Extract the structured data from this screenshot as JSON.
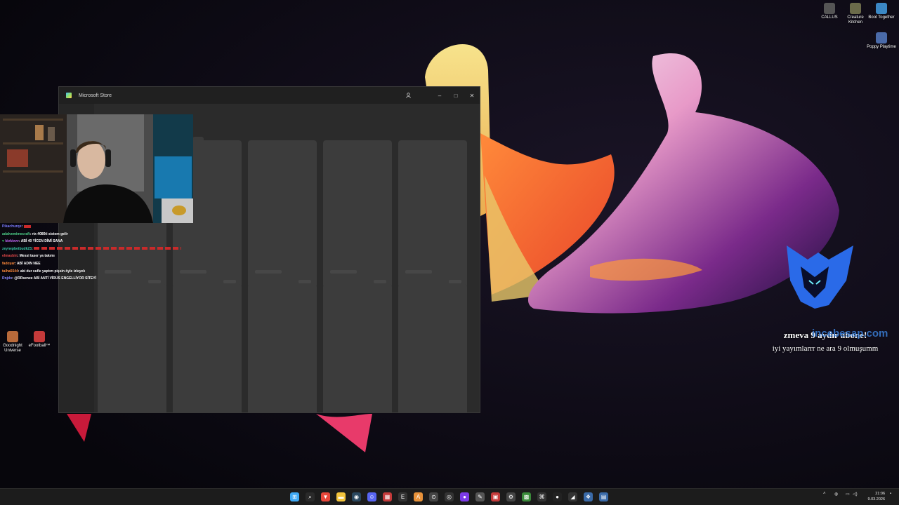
{
  "desktop": {
    "icons_right": [
      {
        "label": "CALLUS",
        "icon": "game-icon",
        "color": "#555555"
      },
      {
        "label": "Creature Kitchen",
        "icon": "game-icon",
        "color": "#6b6b4a"
      },
      {
        "label": "Boot Together",
        "icon": "game-icon",
        "color": "#3b88c4"
      },
      {
        "label": "Poppy Playtime",
        "icon": "game-icon",
        "color": "#4a6aa8"
      }
    ],
    "icons_left": [
      {
        "label": "Goodnight Universe",
        "icon": "game-icon",
        "color": "#b86a3a"
      },
      {
        "label": "eFootball™",
        "icon": "game-icon",
        "color": "#c43a3a"
      }
    ]
  },
  "store_window": {
    "title": "Microsoft Store",
    "buttons": {
      "account": "account-icon",
      "minimize": "–",
      "maximize": "□",
      "close": "✕"
    },
    "loading": true
  },
  "chat": [
    {
      "user": "Pikachuzqe",
      "user_color": "#7b7bff",
      "message": "",
      "message_color": "#ff3b3b"
    },
    {
      "user": "adalvemimecraft",
      "user_color": "#4fd18a",
      "message": "rtx 4080ti sistem gelir",
      "message_color": "#ffffff"
    },
    {
      "user": "kivkivvv",
      "user_color": "#c86cff",
      "message": "ABİ 40 YİCEN DİMİ SANA",
      "message_color": "#ffffff"
    },
    {
      "user": "zeynepbetbudk23",
      "user_color": "#38c9a8",
      "message": "",
      "message_color": "#ff3b3b"
    },
    {
      "user": "elmasbin",
      "user_color": "#e04848",
      "message": "Messi taser ya takımı",
      "message_color": "#ffffff"
    },
    {
      "user": "fadoyar",
      "user_color": "#ff8a3a",
      "message": "ABİ ADIN NEE",
      "message_color": "#ffffff"
    },
    {
      "user": "talha5544",
      "user_color": "#ff8a3a",
      "message": "abi dur sufle yaptım pişsin öyle izleyek",
      "message_color": "#ffffff"
    },
    {
      "user": "Rnjdo",
      "user_color": "#8a8aff",
      "message": "@RRsenee ABİ ANTİ VİRÜS ENGELLİYOR SİTEYİ",
      "message_color": "#ffffff"
    }
  ],
  "alert": {
    "line1": "zmeva 9 aydır abone!",
    "line2": "iyi yayımlarrr ne ara 9 olmuşumm",
    "site": "incebesap.com"
  },
  "taskbar": {
    "icons": [
      {
        "name": "start-icon",
        "color": "#3fa9f5",
        "glyph": "⊞"
      },
      {
        "name": "search-icon",
        "color": "#2a2a2a",
        "glyph": "⌕"
      },
      {
        "name": "brave-icon",
        "color": "#e8473a",
        "glyph": "▼"
      },
      {
        "name": "file-explorer-icon",
        "color": "#f3c43c",
        "glyph": "▬"
      },
      {
        "name": "steam-icon",
        "color": "#2a475e",
        "glyph": "◉"
      },
      {
        "name": "discord-icon",
        "color": "#5865f2",
        "glyph": "☺"
      },
      {
        "name": "calendar-icon",
        "color": "#c43a3a",
        "glyph": "▦"
      },
      {
        "name": "epic-games-icon",
        "color": "#333333",
        "glyph": "E"
      },
      {
        "name": "aimp-icon",
        "color": "#e8923a",
        "glyph": "A"
      },
      {
        "name": "app-icon",
        "color": "#444444",
        "glyph": "⊙"
      },
      {
        "name": "obs-icon",
        "color": "#333333",
        "glyph": "◎"
      },
      {
        "name": "purple-app-icon",
        "color": "#7b3ae8",
        "glyph": "●"
      },
      {
        "name": "app-icon",
        "color": "#555555",
        "glyph": "✎"
      },
      {
        "name": "app-icon",
        "color": "#c43a3a",
        "glyph": "▣"
      },
      {
        "name": "settings-icon",
        "color": "#444444",
        "glyph": "⚙"
      },
      {
        "name": "minecraft-icon",
        "color": "#3a8a3a",
        "glyph": "▩"
      },
      {
        "name": "app-icon",
        "color": "#333333",
        "glyph": "⌘"
      },
      {
        "name": "app-icon",
        "color": "#222222",
        "glyph": "●"
      },
      {
        "name": "app-icon",
        "color": "#333333",
        "glyph": "◢"
      },
      {
        "name": "app-icon",
        "color": "#3a6aa8",
        "glyph": "❖"
      },
      {
        "name": "microsoft-store-icon",
        "color": "#3a6aa8",
        "glyph": "▤"
      }
    ],
    "clock_time": "21:06",
    "clock_date": "9.03.2026"
  }
}
